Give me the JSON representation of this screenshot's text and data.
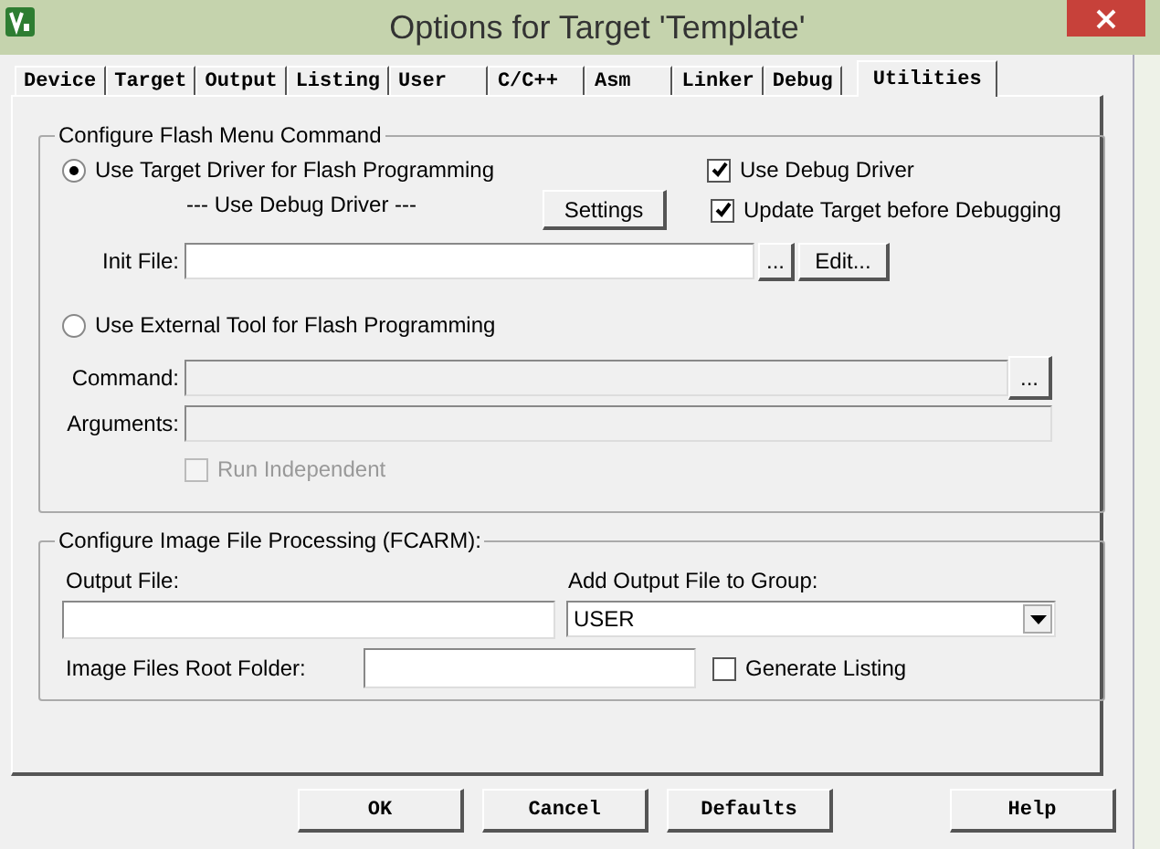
{
  "window": {
    "title": "Options for Target 'Template'"
  },
  "tabs": [
    {
      "label": "Device",
      "selected": false
    },
    {
      "label": "Target",
      "selected": false
    },
    {
      "label": "Output",
      "selected": false
    },
    {
      "label": "Listing",
      "selected": false
    },
    {
      "label": "User",
      "selected": false
    },
    {
      "label": "C/C++",
      "selected": false
    },
    {
      "label": "Asm",
      "selected": false
    },
    {
      "label": "Linker",
      "selected": false
    },
    {
      "label": "Debug",
      "selected": false
    },
    {
      "label": "Utilities",
      "selected": true
    }
  ],
  "flash_group": {
    "title": "Configure Flash Menu Command",
    "target_driver": {
      "label": "Use Target Driver for Flash Programming",
      "selected": true
    },
    "use_debug_driver": {
      "label": "Use Debug Driver",
      "checked": true
    },
    "driver_label": "--- Use Debug Driver ---",
    "settings_button": "Settings",
    "update_target": {
      "label": "Update Target before Debugging",
      "checked": true
    },
    "init_file": {
      "label": "Init File:",
      "browse": "...",
      "edit": "Edit..."
    },
    "external_tool": {
      "label": "Use External Tool for Flash Programming",
      "selected": false
    },
    "command": {
      "label": "Command:",
      "browse": "..."
    },
    "arguments": {
      "label": "Arguments:"
    },
    "run_independent": {
      "label": "Run Independent",
      "checked": false,
      "disabled": true
    }
  },
  "image_group": {
    "title": "Configure Image File Processing (FCARM):",
    "output_file_label": "Output File:",
    "add_group_label": "Add Output File  to Group:",
    "group_value": "USER",
    "root_folder_label": "Image Files Root Folder:",
    "generate_listing": {
      "label": "Generate Listing",
      "checked": false
    }
  },
  "buttons": [
    "OK",
    "Cancel",
    "Defaults",
    "Help"
  ]
}
